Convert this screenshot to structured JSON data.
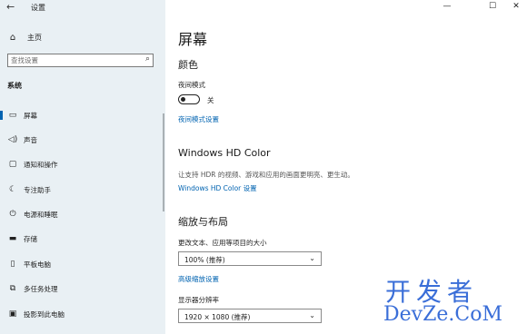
{
  "window": {
    "title": "设置",
    "controls": {
      "minimize": "—",
      "maximize": "☐",
      "close": "✕"
    }
  },
  "sidebar": {
    "home_label": "主页",
    "search_placeholder": "查找设置",
    "section_title": "系统",
    "items": [
      {
        "label": "屏幕",
        "icon": "monitor-icon",
        "active": true
      },
      {
        "label": "声音",
        "icon": "speaker-icon"
      },
      {
        "label": "通知和操作",
        "icon": "notification-icon"
      },
      {
        "label": "专注助手",
        "icon": "moon-icon"
      },
      {
        "label": "电源和睡眠",
        "icon": "power-icon"
      },
      {
        "label": "存储",
        "icon": "storage-icon"
      },
      {
        "label": "平板电脑",
        "icon": "tablet-icon"
      },
      {
        "label": "多任务处理",
        "icon": "multitask-icon"
      },
      {
        "label": "投影到此电脑",
        "icon": "project-icon"
      }
    ]
  },
  "main": {
    "title": "屏幕",
    "color": {
      "heading": "颜色",
      "night_mode_label": "夜间模式",
      "toggle_state": "关",
      "night_mode_settings_link": "夜间模式设置"
    },
    "hd_color": {
      "heading": "Windows HD Color",
      "description": "让支持 HDR 的视频、游戏和应用的画面更明亮、更生动。",
      "settings_link": "Windows HD Color 设置"
    },
    "scale_layout": {
      "heading": "缩放与布局",
      "scale_label": "更改文本、应用等项目的大小",
      "scale_value": "100% (推荐)",
      "advanced_link": "高级缩放设置",
      "resolution_label": "显示器分辨率",
      "resolution_value": "1920 × 1080 (推荐)"
    }
  },
  "watermark": {
    "top": "开发者",
    "bottom": "DevZe.CoM"
  },
  "colors": {
    "accent": "#0063b1",
    "sidebar_bg": "#e9f0f4",
    "watermark": "#3a6ed8"
  }
}
